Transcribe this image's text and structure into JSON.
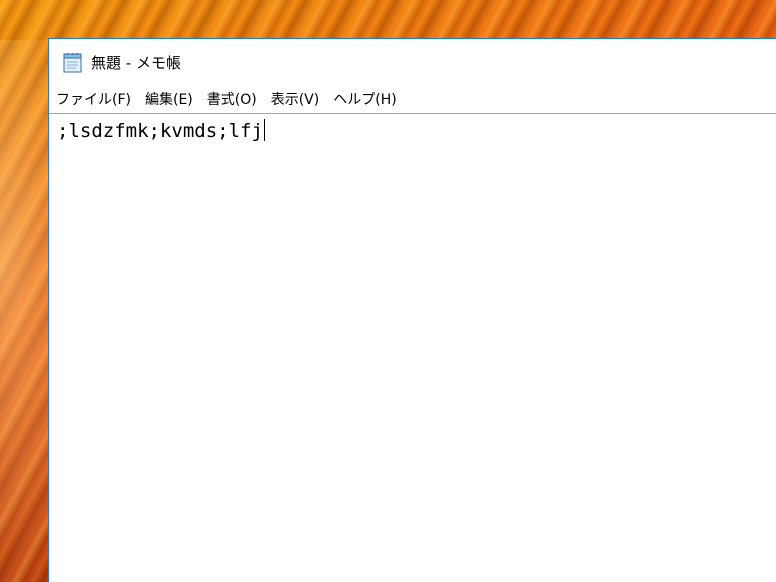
{
  "window": {
    "title": "無題 - メモ帳",
    "icon": "notepad-icon"
  },
  "menu": {
    "items": [
      {
        "label": "ファイル(F)"
      },
      {
        "label": "編集(E)"
      },
      {
        "label": "書式(O)"
      },
      {
        "label": "表示(V)"
      },
      {
        "label": "ヘルプ(H)"
      }
    ]
  },
  "editor": {
    "text": ";lsdzfmk;kvmds;lfj"
  },
  "colors": {
    "window_border": "#1c7fd6",
    "editor_border": "#6fb3ea",
    "background": "#ffffff"
  }
}
